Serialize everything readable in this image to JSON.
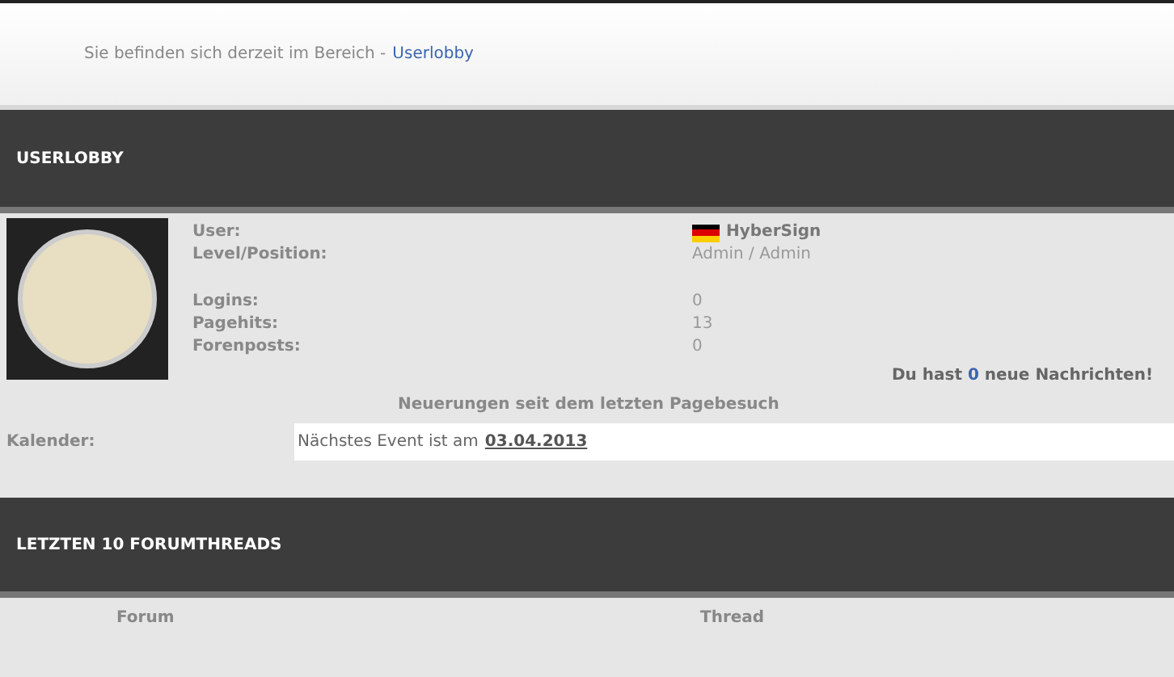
{
  "breadcrumb": {
    "text": "Sie befinden sich derzeit im Bereich -",
    "link": "Userlobby"
  },
  "userlobby": {
    "title": "USERLOBBY",
    "profile": [
      {
        "label": "User:",
        "value": "HyberSign",
        "kind": "user"
      },
      {
        "label": "Level/Position:",
        "value": "Admin / Admin",
        "kind": "plain"
      }
    ],
    "stats": [
      {
        "label": "Logins:",
        "value": "0",
        "kind": "plain"
      },
      {
        "label": "Pagehits:",
        "value": "13",
        "kind": "plain"
      },
      {
        "label": "Forenposts:",
        "value": "0",
        "kind": "plain"
      }
    ],
    "messages": {
      "before": "Du hast",
      "count": "0",
      "after": "neue Nachrichten!"
    },
    "news_heading": "Neuerungen seit dem letzten Pagebesuch",
    "calendar": {
      "label": "Kalender:",
      "text": "Nächstes Event ist am",
      "date": "03.04.2013"
    }
  },
  "forumthreads": {
    "title": "LETZTEN 10 FORUMTHREADS",
    "columns": [
      "Forum",
      "Thread"
    ]
  }
}
